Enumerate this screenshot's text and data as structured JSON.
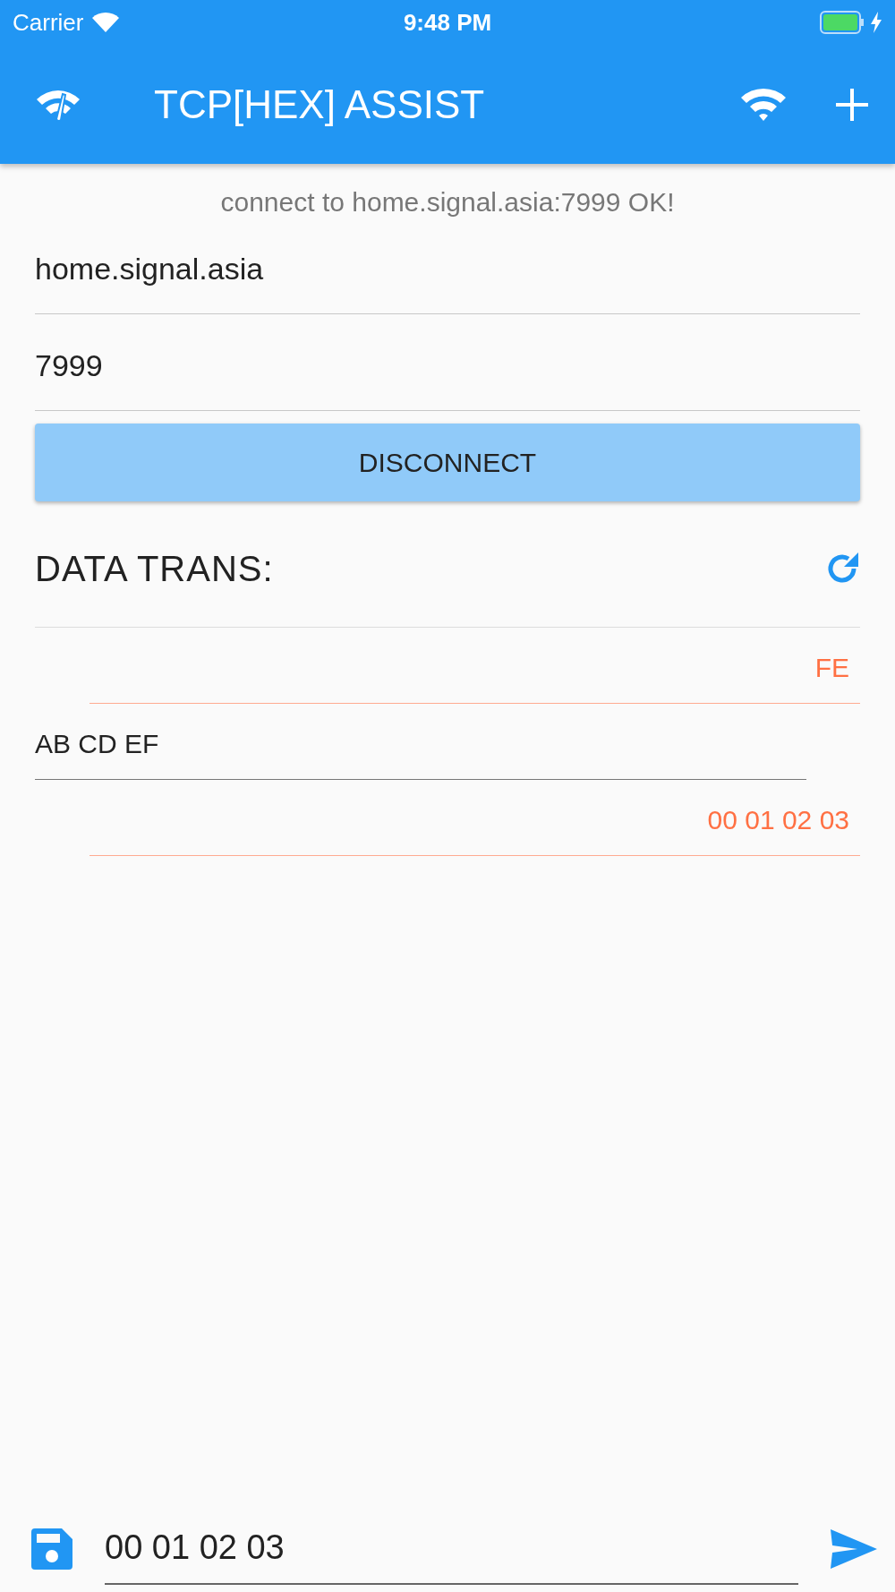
{
  "status_bar": {
    "carrier": "Carrier",
    "time": "9:48 PM",
    "charging": true
  },
  "app_bar": {
    "title": "TCP[HEX] ASSIST"
  },
  "status_message": "connect to home.signal.asia:7999 OK!",
  "host_field": {
    "value": "home.signal.asia"
  },
  "port_field": {
    "value": "7999"
  },
  "connect_button": {
    "label": "DISCONNECT"
  },
  "section_title": "DATA TRANS:",
  "messages": [
    {
      "kind": "received",
      "text": "FE"
    },
    {
      "kind": "sent",
      "text": "AB CD EF"
    },
    {
      "kind": "received",
      "text": "00 01 02 03"
    }
  ],
  "send_field": {
    "value": "00 01 02 03"
  }
}
